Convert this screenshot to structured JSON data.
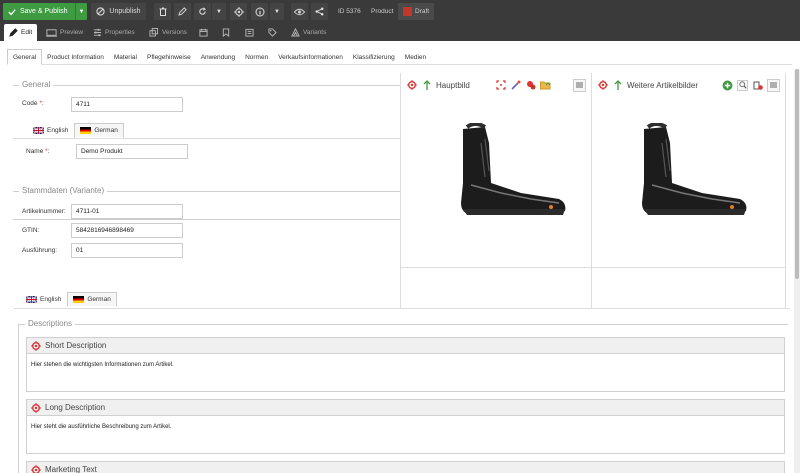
{
  "toolbar": {
    "save_publish": "Save & Publish",
    "unpublish": "Unpublish",
    "id_label": "ID 5376",
    "type_label": "Product",
    "status": "Draft"
  },
  "subtabs": {
    "edit": "Edit",
    "preview": "Preview",
    "properties": "Properties",
    "versions": "Versions",
    "variants": "Variants"
  },
  "tabs": [
    "General",
    "Product Information",
    "Material",
    "Pflegehinweise",
    "Anwendung",
    "Normen",
    "Verkaufsinformationen",
    "Klassifizierung",
    "Medien"
  ],
  "general": {
    "legend": "General",
    "code_label": "Code",
    "code_value": "4711",
    "lang_en": "English",
    "lang_de": "German",
    "name_label": "Name",
    "name_value": "Demo Produkt"
  },
  "stamm": {
    "legend": "Stammdaten (Variante)",
    "artikel_label": "Artikelnummer:",
    "artikel_value": "4711-01",
    "gtin_label": "GTIN:",
    "gtin_value": "5842816946898469",
    "ausf_label": "Ausführung:",
    "ausf_value": "01"
  },
  "images": {
    "main_title": "Hauptbild",
    "more_title": "Weitere Artikelbilder"
  },
  "descriptions": {
    "lang_en": "English",
    "lang_de": "German",
    "legend": "Descriptions",
    "short_title": "Short Description",
    "short_text": "Hier stehen die wichtigsten Informationen zum Artikel.",
    "long_title": "Long Description",
    "long_text": "Hier steht die ausführliche Beschreibung zum Artikel.",
    "marketing_title": "Marketing Text"
  },
  "colors": {
    "accent_green": "#3f9b42",
    "toolbar_bg": "#3a3a3a",
    "required_red": "#dd3333",
    "draft_red": "#c0392b"
  }
}
